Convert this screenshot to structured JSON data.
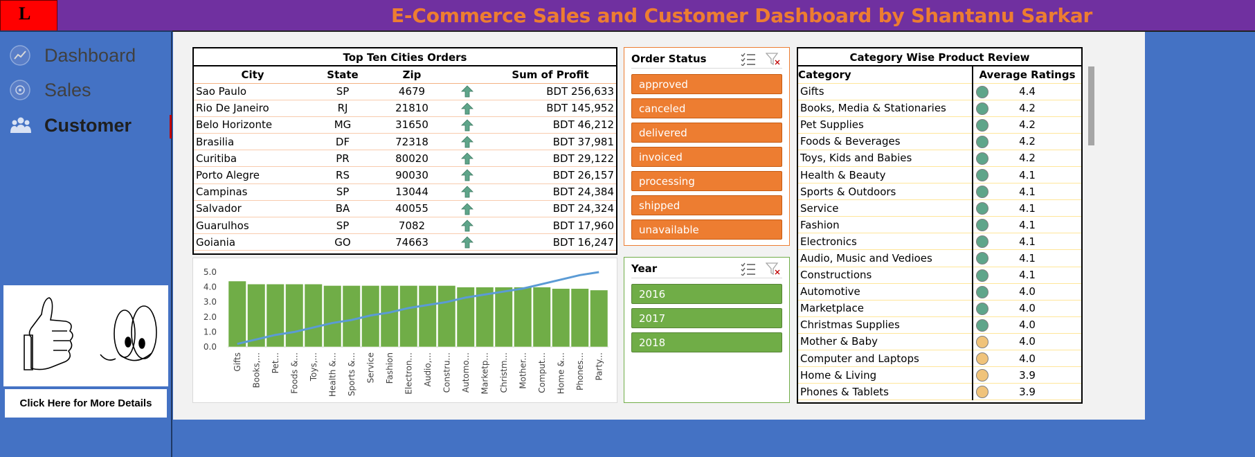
{
  "header": {
    "title": "E-Commerce Sales and Customer Dashboard by Shantanu Sarkar",
    "logo_letter": "L",
    "bg_color": "#7030a0",
    "title_color": "#ed7d31"
  },
  "sidebar": {
    "items": [
      {
        "label": "Dashboard",
        "icon": "line-chart-icon",
        "active": false
      },
      {
        "label": "Sales",
        "icon": "sales-icon",
        "active": false
      },
      {
        "label": "Customer",
        "icon": "customers-icon",
        "active": true
      }
    ],
    "promo_icon": "thumbs-up-eyes-icon",
    "details_button": "Click Here for More Details"
  },
  "cities": {
    "title": "Top Ten Cities Orders",
    "headers": [
      "City",
      "State",
      "Zip",
      "Sum of Profit"
    ],
    "rows": [
      {
        "city": "Sao Paulo",
        "state": "SP",
        "zip": "4679",
        "profit": "BDT 256,633"
      },
      {
        "city": "Rio De Janeiro",
        "state": "RJ",
        "zip": "21810",
        "profit": "BDT 145,952"
      },
      {
        "city": "Belo Horizonte",
        "state": "MG",
        "zip": "31650",
        "profit": "BDT 46,212"
      },
      {
        "city": "Brasilia",
        "state": "DF",
        "zip": "72318",
        "profit": "BDT 37,981"
      },
      {
        "city": "Curitiba",
        "state": "PR",
        "zip": "80020",
        "profit": "BDT 29,122"
      },
      {
        "city": "Porto Alegre",
        "state": "RS",
        "zip": "90030",
        "profit": "BDT 26,157"
      },
      {
        "city": "Campinas",
        "state": "SP",
        "zip": "13044",
        "profit": "BDT 24,384"
      },
      {
        "city": "Salvador",
        "state": "BA",
        "zip": "40055",
        "profit": "BDT 24,324"
      },
      {
        "city": "Guarulhos",
        "state": "SP",
        "zip": "7082",
        "profit": "BDT 17,960"
      },
      {
        "city": "Goiania",
        "state": "GO",
        "zip": "74663",
        "profit": "BDT 16,247"
      }
    ],
    "arrow_icon": "up-arrow-icon",
    "arrow_color": "#70ad8f"
  },
  "order_status": {
    "title": "Order Status",
    "items": [
      "approved",
      "canceled",
      "delivered",
      "invoiced",
      "processing",
      "shipped",
      "unavailable"
    ],
    "color": "#ed7d31"
  },
  "year": {
    "title": "Year",
    "items": [
      "2016",
      "2017",
      "2018"
    ],
    "color": "#70ad47"
  },
  "categories": {
    "title": "Category Wise Product Review",
    "headers": [
      "Category",
      "Average Ratings"
    ],
    "rows": [
      {
        "name": "Gifts",
        "rating": "4.4",
        "level": "high"
      },
      {
        "name": "Books, Media & Stationaries",
        "rating": "4.2",
        "level": "high"
      },
      {
        "name": "Pet Supplies",
        "rating": "4.2",
        "level": "high"
      },
      {
        "name": "Foods & Beverages",
        "rating": "4.2",
        "level": "high"
      },
      {
        "name": "Toys, Kids and Babies",
        "rating": "4.2",
        "level": "high"
      },
      {
        "name": "Health & Beauty",
        "rating": "4.1",
        "level": "high"
      },
      {
        "name": "Sports & Outdoors",
        "rating": "4.1",
        "level": "high"
      },
      {
        "name": "Service",
        "rating": "4.1",
        "level": "high"
      },
      {
        "name": "Fashion",
        "rating": "4.1",
        "level": "high"
      },
      {
        "name": "Electronics",
        "rating": "4.1",
        "level": "high"
      },
      {
        "name": "Audio, Music and Vedioes",
        "rating": "4.1",
        "level": "high"
      },
      {
        "name": "Constructions",
        "rating": "4.1",
        "level": "high"
      },
      {
        "name": "Automotive",
        "rating": "4.0",
        "level": "high"
      },
      {
        "name": "Marketplace",
        "rating": "4.0",
        "level": "high"
      },
      {
        "name": "Christmas Supplies",
        "rating": "4.0",
        "level": "high"
      },
      {
        "name": "Mother & Baby",
        "rating": "4.0",
        "level": "mid"
      },
      {
        "name": "Computer and Laptops",
        "rating": "4.0",
        "level": "mid"
      },
      {
        "name": "Home & Living",
        "rating": "3.9",
        "level": "mid"
      },
      {
        "name": "Phones & Tablets",
        "rating": "3.9",
        "level": "mid"
      }
    ],
    "colors": {
      "high": "#5fa58a",
      "mid": "#f0c37a"
    }
  },
  "chart_data": {
    "type": "bar",
    "categories": [
      "Gifts",
      "Books,...",
      "Pet...",
      "Foods &...",
      "Toys,...",
      "Health &...",
      "Sports &...",
      "Service",
      "Fashion",
      "Electron...",
      "Audio,...",
      "Constru...",
      "Automo...",
      "Marketp...",
      "Christm...",
      "Mother...",
      "Comput...",
      "Home &...",
      "Phones...",
      "Party..."
    ],
    "series": [
      {
        "type": "bar",
        "values": [
          4.4,
          4.2,
          4.2,
          4.2,
          4.2,
          4.1,
          4.1,
          4.1,
          4.1,
          4.1,
          4.1,
          4.1,
          4.0,
          4.0,
          4.0,
          4.0,
          4.0,
          3.9,
          3.9,
          3.8
        ],
        "color": "#70ad47"
      },
      {
        "type": "line",
        "values": [
          0.2,
          0.5,
          0.8,
          1.0,
          1.3,
          1.6,
          1.8,
          2.1,
          2.3,
          2.6,
          2.8,
          3.0,
          3.3,
          3.5,
          3.7,
          3.9,
          4.2,
          4.5,
          4.8,
          5.0
        ],
        "color": "#5b9bd5"
      }
    ],
    "yticks": [
      "0.0",
      "1.0",
      "2.0",
      "3.0",
      "4.0",
      "5.0"
    ],
    "ylim": [
      0,
      5
    ],
    "grid": false
  }
}
